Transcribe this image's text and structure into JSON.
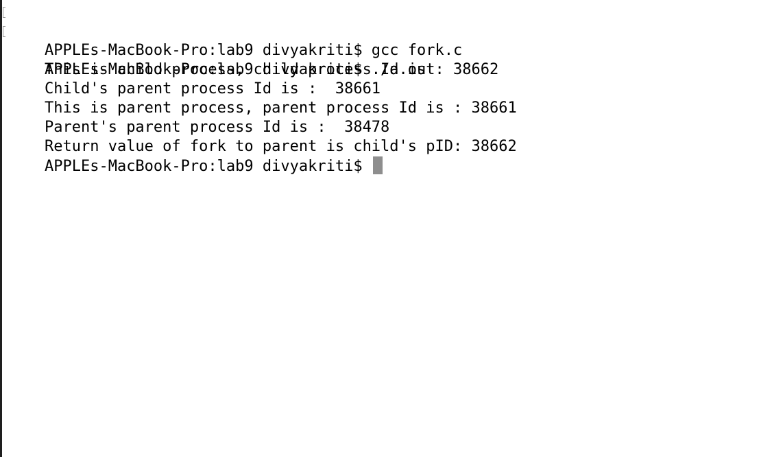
{
  "terminal": {
    "cursor_color": "#8e8e8e",
    "lines": [
      {
        "text": "APPLEs-MacBook-Pro:lab9 divyakriti$ gcc fork.c",
        "marked": true
      },
      {
        "text": "APPLEs-MacBook-Pro:lab9 divyakriti$ ./a.out",
        "marked": true
      },
      {
        "text": "This is child process, child process Id is : 38662",
        "marked": false
      },
      {
        "text": "Child's parent process Id is :  38661",
        "marked": false
      },
      {
        "text": "This is parent process, parent process Id is : 38661",
        "marked": false
      },
      {
        "text": "Parent's parent process Id is :  38478",
        "marked": false
      },
      {
        "text": "Return value of fork to parent is child's pID: 38662",
        "marked": false
      }
    ],
    "prompt": "APPLEs-MacBook-Pro:lab9 divyakriti$ "
  }
}
